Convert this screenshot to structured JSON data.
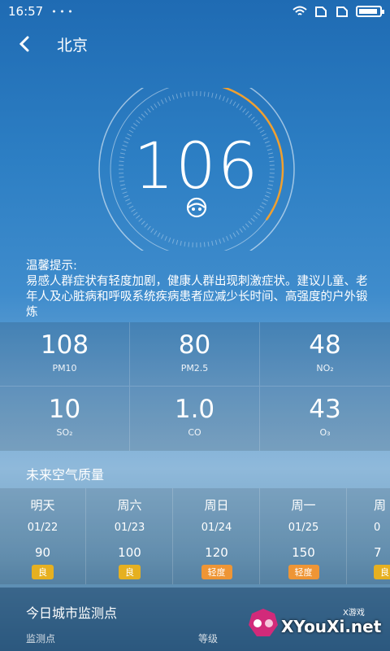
{
  "status": {
    "time": "16:57",
    "extra": "• • •"
  },
  "header": {
    "city": "北京"
  },
  "aqi": {
    "value": "106",
    "progress": 0.35,
    "accent": "#f0a030"
  },
  "tip": {
    "title": "温馨提示:",
    "text": "易感人群症状有轻度加剧，健康人群出现刺激症状。建议儿童、老年人及心脏病和呼吸系统疾病患者应减少长时间、高强度的户外锻炼"
  },
  "pollutants": [
    {
      "value": "108",
      "label": "PM10"
    },
    {
      "value": "80",
      "label": "PM2.5"
    },
    {
      "value": "48",
      "label": "NO₂"
    },
    {
      "value": "10",
      "label": "SO₂"
    },
    {
      "value": "1.0",
      "label": "CO"
    },
    {
      "value": "43",
      "label": "O₃"
    }
  ],
  "future": {
    "title": "未来空气质量",
    "days": [
      {
        "name": "明天",
        "date": "01/22",
        "value": "90",
        "level": "良",
        "color": "#e6b020"
      },
      {
        "name": "周六",
        "date": "01/23",
        "value": "100",
        "level": "良",
        "color": "#e6b020"
      },
      {
        "name": "周日",
        "date": "01/24",
        "value": "120",
        "level": "轻度",
        "color": "#ee9535"
      },
      {
        "name": "周一",
        "date": "01/25",
        "value": "150",
        "level": "轻度",
        "color": "#ee9535"
      },
      {
        "name": "周",
        "date": "0",
        "value": "7",
        "level": "良",
        "color": "#e6b020"
      }
    ]
  },
  "monitor": {
    "title": "今日城市监测点",
    "col1": "监测点",
    "col2": "等级"
  },
  "watermark": {
    "brand": "XYouXi.net",
    "tag": "X游戏"
  }
}
